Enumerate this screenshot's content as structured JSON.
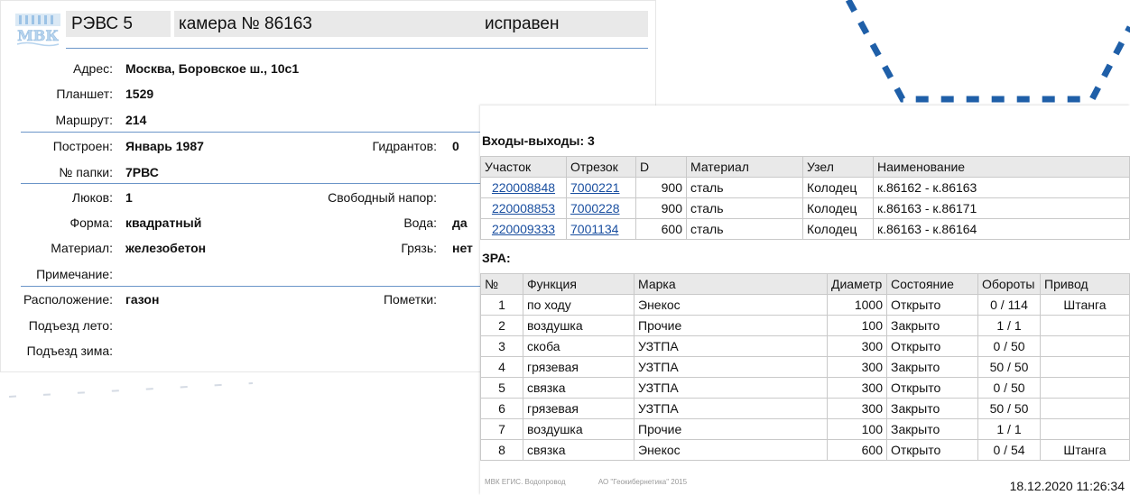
{
  "header": {
    "logo_text": "МВК",
    "district": "РЭВС 5",
    "camera": "камера № 86163",
    "status": "исправен"
  },
  "info": {
    "address_label": "Адрес:",
    "address": "Москва, Боровское ш., 10с1",
    "tablet_label": "Планшет:",
    "tablet": "1529",
    "route_label": "Маршрут:",
    "route": "214",
    "built_label": "Построен:",
    "built": "Январь 1987",
    "hydrants_label": "Гидрантов:",
    "hydrants": "0",
    "folder_label": "№ папки:",
    "folder": "7РВС",
    "hatches_label": "Люков:",
    "hatches": "1",
    "free_head_label": "Свободный напор:",
    "shape_label": "Форма:",
    "shape": "квадратный",
    "water_label": "Вода:",
    "water": "да",
    "material_label": "Материал:",
    "material": "железобетон",
    "dirt_label": "Грязь:",
    "dirt": "нет",
    "note_label": "Примечание:",
    "location_label": "Расположение:",
    "location": "газон",
    "marks_label": "Пометки:",
    "summer_label": "Подъезд лето:",
    "winter_label": "Подъезд зима:"
  },
  "io": {
    "title": "Входы-выходы: 3",
    "headers": [
      "Участок",
      "Отрезок",
      "D",
      "Материал",
      "Узел",
      "Наименование"
    ],
    "rows": [
      [
        "220008848",
        "7000221",
        "900",
        "сталь",
        "Колодец",
        "к.86162 - к.86163"
      ],
      [
        "220008853",
        "7000228",
        "900",
        "сталь",
        "Колодец",
        "к.86163 - к.86171"
      ],
      [
        "220009333",
        "7001134",
        "600",
        "сталь",
        "Колодец",
        "к.86163 - к.86164"
      ]
    ]
  },
  "zra": {
    "title": "ЗРА:",
    "headers": [
      "№",
      "Функция",
      "Марка",
      "Диаметр",
      "Состояние",
      "Обороты",
      "Привод"
    ],
    "rows": [
      [
        "1",
        "по ходу",
        "Энекос",
        "1000",
        "Открыто",
        "0 / 114",
        "Штанга"
      ],
      [
        "2",
        "воздушка",
        "Прочие",
        "100",
        "Закрыто",
        "1 / 1",
        ""
      ],
      [
        "3",
        "скоба",
        "УЗТПА",
        "300",
        "Открыто",
        "0 / 50",
        ""
      ],
      [
        "4",
        "грязевая",
        "УЗТПА",
        "300",
        "Закрыто",
        "50 / 50",
        ""
      ],
      [
        "5",
        "связка",
        "УЗТПА",
        "300",
        "Открыто",
        "0 / 50",
        ""
      ],
      [
        "6",
        "грязевая",
        "УЗТПА",
        "300",
        "Закрыто",
        "50 / 50",
        ""
      ],
      [
        "7",
        "воздушка",
        "Прочие",
        "100",
        "Закрыто",
        "1 / 1",
        ""
      ],
      [
        "8",
        "связка",
        "Энекос",
        "600",
        "Открыто",
        "0 / 54",
        "Штанга"
      ]
    ]
  },
  "footer": {
    "system": "МВК ЕГИС. Водопровод",
    "company": "АО \"Геокибернетика\" 2015",
    "timestamp": "18.12.2020 11:26:34"
  },
  "colors": {
    "accent": "#1f5fa8",
    "link": "#1a4fa0",
    "rule": "#6b95c8",
    "header_bg": "#e9e9e9"
  }
}
